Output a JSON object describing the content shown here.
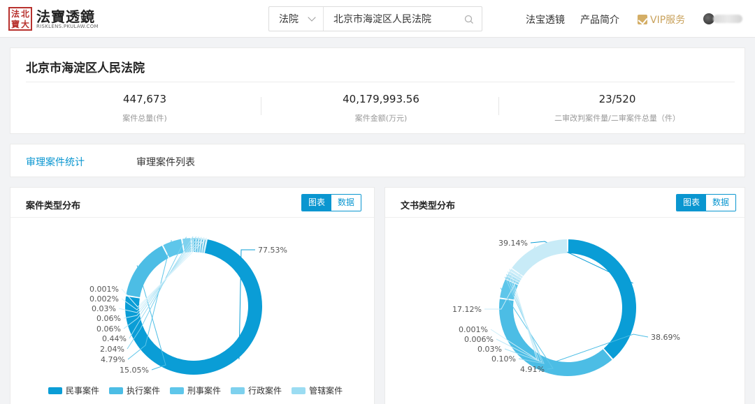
{
  "header": {
    "logo_seal": [
      "法",
      "北",
      "寶",
      "大"
    ],
    "logo_name": "法寶透鏡",
    "logo_domain": "RISKLENS.PKULAW.COM",
    "search": {
      "category": "法院",
      "value": "北京市海淀区人民法院",
      "icon": "search-icon"
    },
    "nav": {
      "item1": "法宝透镜",
      "item2": "产品简介",
      "vip": "VIP服务"
    }
  },
  "court": {
    "name": "北京市海淀区人民法院",
    "stats": [
      {
        "value": "447,673",
        "label": "案件总量(件)"
      },
      {
        "value": "40,179,993.56",
        "label": "案件金额(万元)"
      },
      {
        "value": "23/520",
        "label": "二审改判案件量/二审案件总量（件）"
      }
    ]
  },
  "tabs": {
    "active": "审理案件统计",
    "inactive": "审理案件列表"
  },
  "panels": {
    "left": {
      "title": "案件类型分布",
      "btn_chart": "图表",
      "btn_data": "数据"
    },
    "right": {
      "title": "文书类型分布",
      "btn_chart": "图表",
      "btn_data": "数据"
    }
  },
  "colors": {
    "accent": "#0a96d0"
  },
  "chart_data": [
    {
      "type": "pie",
      "title": "案件类型分布",
      "slices": [
        {
          "name": "民事案件",
          "value": 77.53,
          "label": "77.53%",
          "color": "#0a9dd6"
        },
        {
          "name": "执行案件",
          "value": 15.05,
          "label": "15.05%",
          "color": "#4cbde5"
        },
        {
          "name": "刑事案件",
          "value": 4.79,
          "label": "4.79%",
          "color": "#5ec6ea"
        },
        {
          "name": "行政案件",
          "value": 2.04,
          "label": "2.04%",
          "color": "#7ed1ee"
        },
        {
          "name": "管辖案件",
          "value": 0.44,
          "label": "0.44%",
          "color": "#9bdcf2"
        },
        {
          "name": "",
          "value": 0.06,
          "label": "0.06%",
          "color": "#aee3f5"
        },
        {
          "name": "",
          "value": 0.06,
          "label": "0.06%",
          "color": "#bde8f7"
        },
        {
          "name": "",
          "value": 0.03,
          "label": "0.03%",
          "color": "#c9ecf8"
        },
        {
          "name": "",
          "value": 0.002,
          "label": "0.002%",
          "color": "#d3f0fa"
        },
        {
          "name": "",
          "value": 0.001,
          "label": "0.001%",
          "color": "#dcf3fb"
        }
      ],
      "legend": [
        "民事案件",
        "执行案件",
        "刑事案件",
        "行政案件",
        "管辖案件"
      ]
    },
    {
      "type": "pie",
      "title": "文书类型分布",
      "slices": [
        {
          "name": "",
          "value": 39.14,
          "label": "39.14%",
          "color": "#0a9dd6"
        },
        {
          "name": "",
          "value": 38.69,
          "label": "38.69%",
          "color": "#4cbde5"
        },
        {
          "name": "",
          "value": 4.91,
          "label": "4.91%",
          "color": "#5ec6ea"
        },
        {
          "name": "",
          "value": 0.1,
          "label": "0.10%",
          "color": "#8fd7f0"
        },
        {
          "name": "",
          "value": 0.03,
          "label": "0.03%",
          "color": "#a9e1f4"
        },
        {
          "name": "",
          "value": 0.006,
          "label": "0.006%",
          "color": "#bfe8f7"
        },
        {
          "name": "",
          "value": 0.001,
          "label": "0.001%",
          "color": "#cdeef9"
        },
        {
          "name": "",
          "value": 17.12,
          "label": "17.12%",
          "color": "#c8ebf7"
        }
      ]
    }
  ]
}
